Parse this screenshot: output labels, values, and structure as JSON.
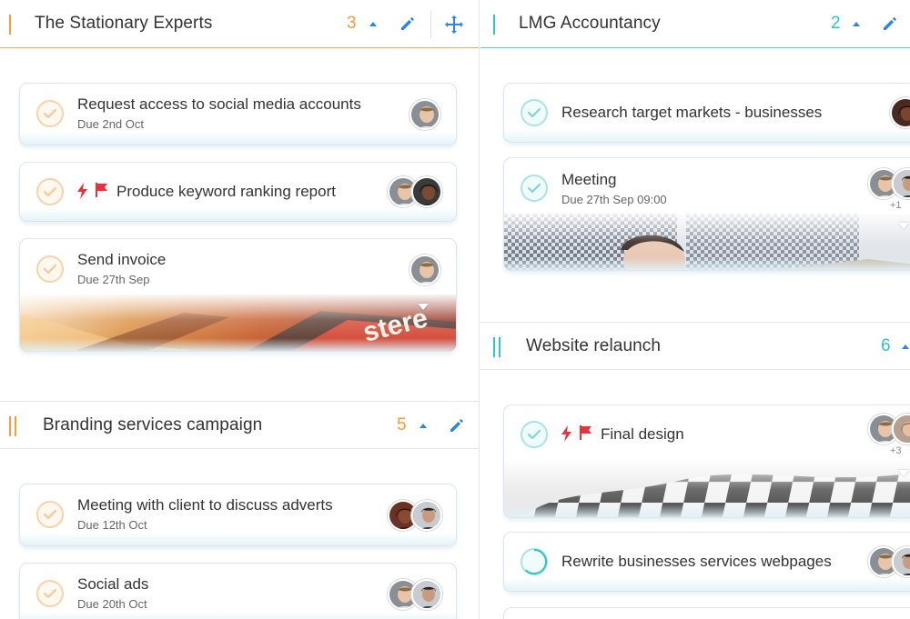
{
  "colors": {
    "orange": "#f39c3c",
    "teal": "#2fc4cb",
    "blue": "#2e86de",
    "flag_red": "#e8323c"
  },
  "groups": {
    "stationary": {
      "title": "The Stationary Experts",
      "count": "3",
      "tasks": [
        {
          "title": "Request access to social media accounts",
          "due": "Due 2nd Oct"
        },
        {
          "title": "Produce keyword ranking report"
        },
        {
          "title": "Send invoice",
          "due": "Due 27th Sep"
        }
      ]
    },
    "branding": {
      "title": "Branding services campaign",
      "count": "5",
      "tasks": [
        {
          "title": "Meeting with client to discuss adverts",
          "due": "Due 12th Oct"
        },
        {
          "title": "Social ads",
          "due": "Due 20th Oct"
        }
      ]
    },
    "lmg": {
      "title": "LMG Accountancy",
      "count": "2",
      "tasks": [
        {
          "title": "Research target markets - businesses"
        },
        {
          "title": "Meeting",
          "due": "Due 27th Sep 09:00",
          "more": "+1"
        }
      ]
    },
    "website": {
      "title": "Website relaunch",
      "count": "6",
      "tasks": [
        {
          "title": "Final design",
          "more": "+3"
        },
        {
          "title": "Rewrite businesses services webpages"
        }
      ]
    }
  }
}
